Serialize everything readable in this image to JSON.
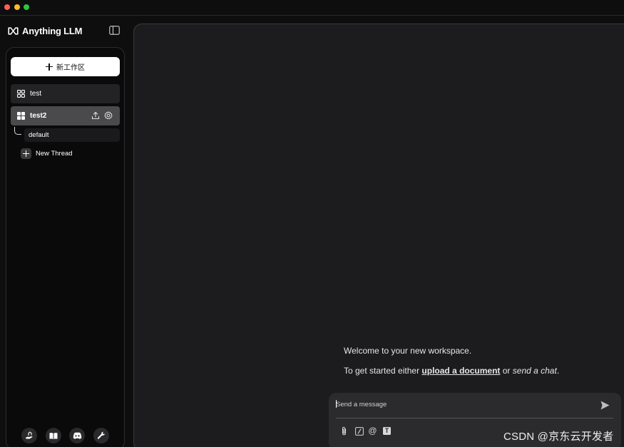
{
  "window": {
    "traffic_lights": [
      {
        "name": "close",
        "color": "#ff5f57"
      },
      {
        "name": "minimize",
        "color": "#febc2e"
      },
      {
        "name": "maximize",
        "color": "#28c840"
      }
    ]
  },
  "brand": {
    "name": "Anything LLM",
    "icon": "infinity-logo-icon"
  },
  "sidebar": {
    "new_workspace_label": "新工作区",
    "workspaces": [
      {
        "label": "test",
        "icon": "grid-icon",
        "active": false
      },
      {
        "label": "test2",
        "icon": "grid-icon",
        "active": true
      }
    ],
    "threads": [
      {
        "label": "default"
      }
    ],
    "new_thread_label": "New Thread",
    "footer_icons": [
      "community-hub-icon",
      "docs-book-icon",
      "discord-icon",
      "settings-wrench-icon"
    ]
  },
  "main": {
    "welcome": "Welcome to your new workspace.",
    "instructions": {
      "prefix": "To get started either ",
      "upload_link": "upload a document",
      "middle": " or ",
      "chat_text": "send a chat",
      "suffix": "."
    },
    "chat": {
      "placeholder": "Send a message",
      "tools": [
        "attachment-icon",
        "slash-command-icon",
        "at-mention-icon",
        "text-size-icon"
      ],
      "at_symbol": "@",
      "text_tool_letter": "T"
    }
  },
  "watermark": "CSDN @京东云开发者",
  "colors": {
    "background": "#0e0e0f",
    "sidebar": "#0a0a0b",
    "main_panel": "#1c1c1e",
    "active_workspace": "#4a4a4d",
    "chat_box": "#2b2b2e"
  }
}
